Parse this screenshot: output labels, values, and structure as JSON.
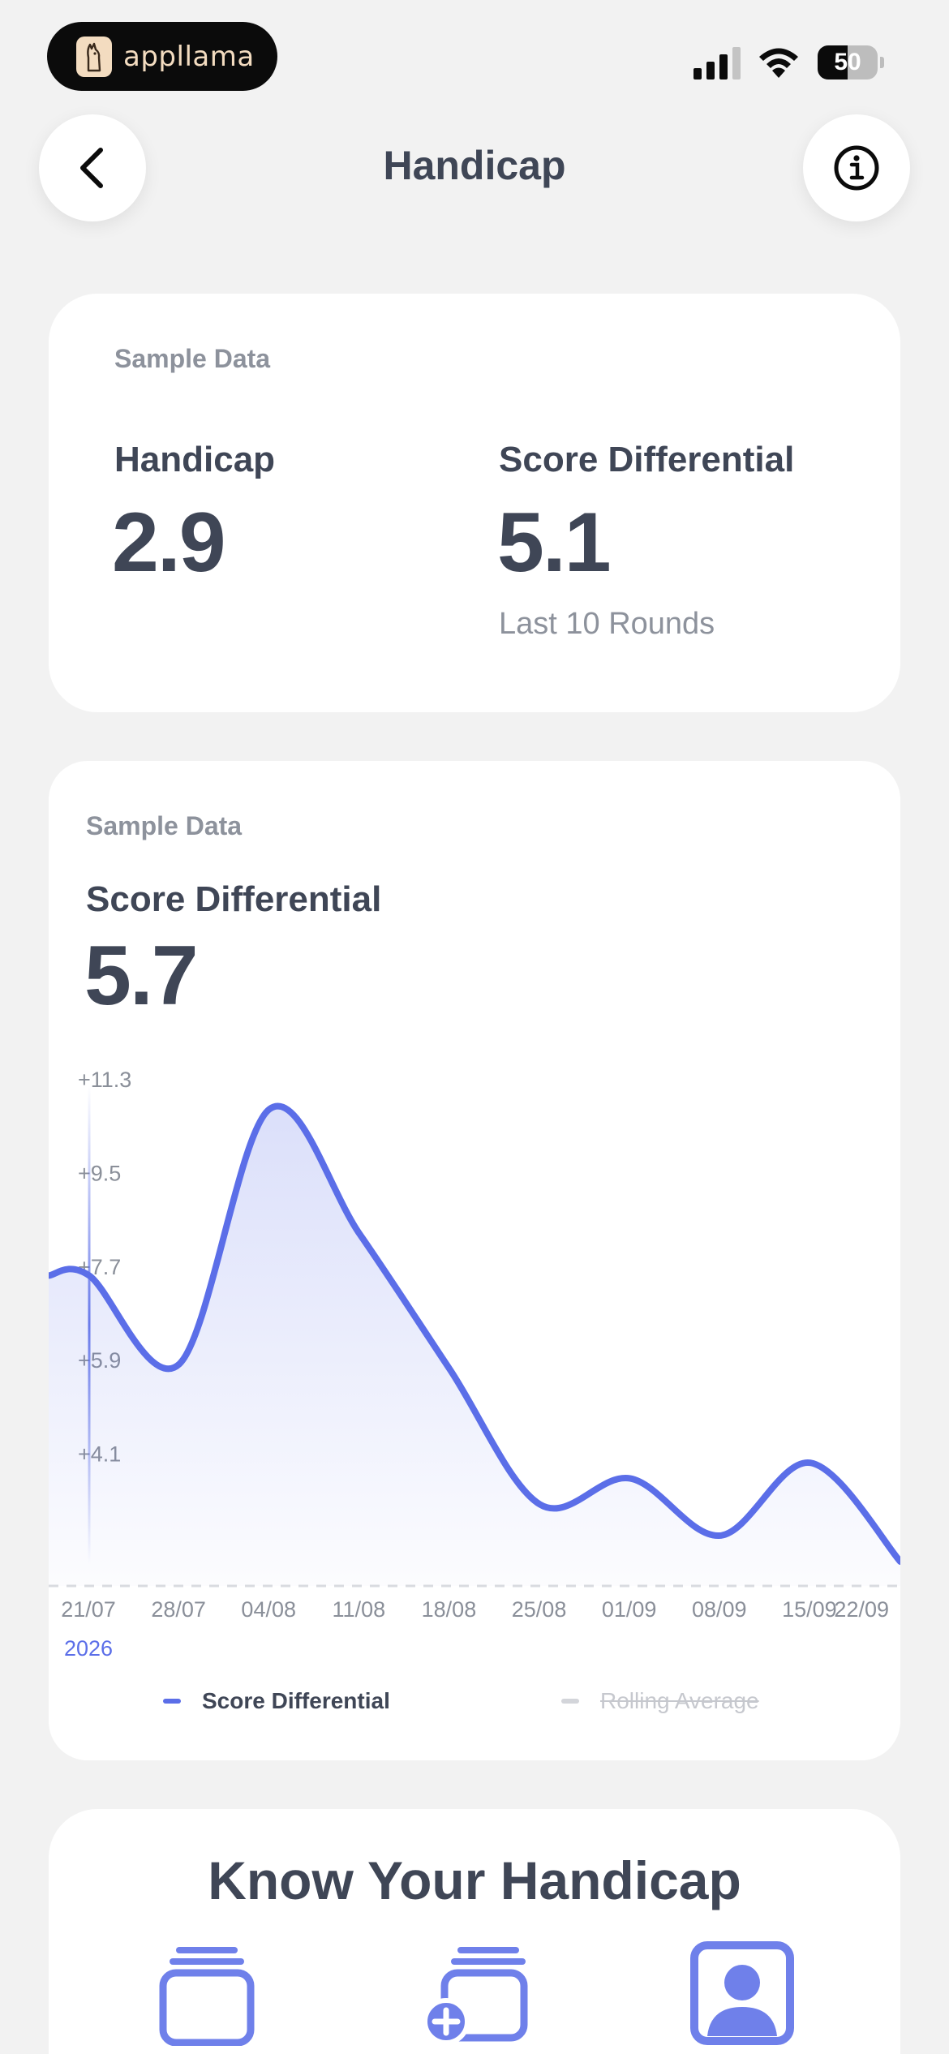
{
  "status_bar": {
    "brand": "appllama",
    "battery_percent": 50,
    "battery_label": "50"
  },
  "header": {
    "title": "Handicap",
    "back_icon": "chevron-left-icon",
    "info_icon": "info-circle-icon"
  },
  "summary_card": {
    "sample_label": "Sample Data",
    "handicap_label": "Handicap",
    "handicap_value": "2.9",
    "differential_label": "Score Differential",
    "differential_value": "5.1",
    "differential_sub": "Last 10 Rounds"
  },
  "chart_card": {
    "sample_label": "Sample Data",
    "title": "Score Differential",
    "value": "5.7",
    "legend": {
      "series_label": "Score Differential",
      "rolling_label": "Rolling Average"
    }
  },
  "chart_data": {
    "type": "area",
    "x": [
      "21/07",
      "28/07",
      "04/08",
      "11/08",
      "18/08",
      "25/08",
      "01/09",
      "08/09",
      "15/09",
      "22/09"
    ],
    "year_label": "2026",
    "y_ticks": [
      "+11.3",
      "+9.5",
      "+7.7",
      "+5.9",
      "+4.1"
    ],
    "y_tick_values": [
      11.3,
      9.5,
      7.7,
      5.9,
      4.1
    ],
    "ylim": [
      2.3,
      11.3
    ],
    "series": [
      {
        "name": "Score Differential",
        "values": [
          7.8,
          6.1,
          11.0,
          8.6,
          6.0,
          3.4,
          3.9,
          2.8,
          4.2,
          2.3
        ],
        "color": "#5b6ee8"
      },
      {
        "name": "Rolling Average",
        "values": [],
        "color": "#d3d5da",
        "hidden": true
      }
    ],
    "grid": false,
    "legend_position": "bottom"
  },
  "know_card": {
    "title": "Know Your Handicap",
    "icons": [
      "stack-cards-icon",
      "add-card-icon",
      "profile-card-icon"
    ],
    "accent": "#6f80ea"
  },
  "colors": {
    "accent": "#5b6ee8",
    "text": "#3f4656",
    "muted": "#8d929c",
    "background": "#f2f2f2"
  }
}
